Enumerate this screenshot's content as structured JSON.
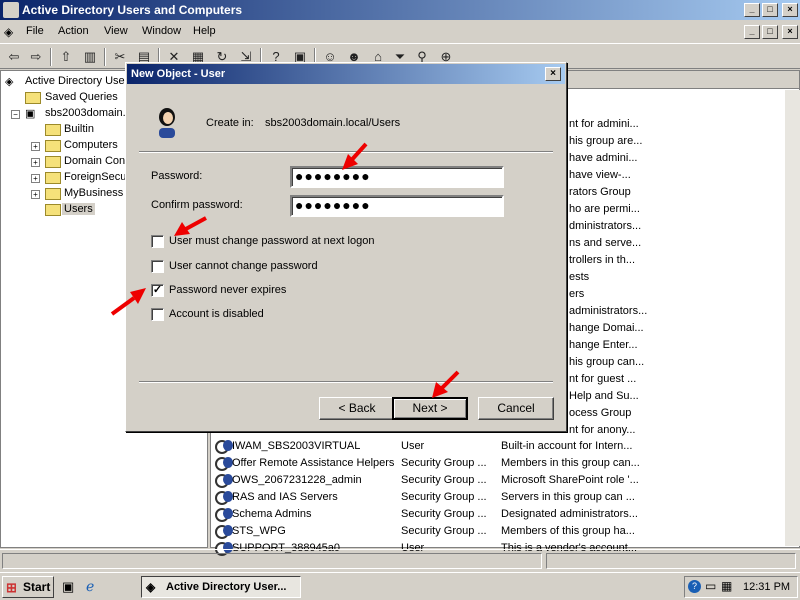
{
  "window": {
    "title": "Active Directory Users and Computers",
    "controls": [
      "_",
      "□",
      "×"
    ]
  },
  "menu": [
    "File",
    "Action",
    "View",
    "Window",
    "Help"
  ],
  "tree": {
    "root": "Active Directory User",
    "items": [
      {
        "label": "Saved Queries"
      },
      {
        "label": "sbs2003domain.l"
      },
      {
        "label": "Builtin"
      },
      {
        "label": "Computers"
      },
      {
        "label": "Domain Cont"
      },
      {
        "label": "ForeignSecur"
      },
      {
        "label": "MyBusiness"
      },
      {
        "label": "Users"
      }
    ]
  },
  "list": {
    "partial_descriptions": [
      "nt for admini...",
      "his group are...",
      "have admini...",
      "have view-...",
      "rators Group",
      "ho are permi...",
      "dministrators...",
      "ns and serve...",
      "trollers in th...",
      "ests",
      "ers",
      "administrators...",
      "hange Domai...",
      "hange Enter...",
      "his group can...",
      "nt for guest ...",
      "Help and Su...",
      "ocess Group",
      "nt for anony..."
    ],
    "rows": [
      {
        "name": "IWAM_SBS2003VIRTUAL",
        "type": "User",
        "description": "Built-in account for Intern..."
      },
      {
        "name": "Offer Remote Assistance Helpers",
        "type": "Security Group ...",
        "description": "Members in this group can..."
      },
      {
        "name": "OWS_2067231228_admin",
        "type": "Security Group ...",
        "description": "Microsoft SharePoint role '..."
      },
      {
        "name": "RAS and IAS Servers",
        "type": "Security Group ...",
        "description": "Servers in this group can ..."
      },
      {
        "name": "Schema Admins",
        "type": "Security Group ...",
        "description": "Designated administrators..."
      },
      {
        "name": "STS_WPG",
        "type": "Security Group ...",
        "description": "Members of this group ha..."
      },
      {
        "name": "SUPPORT_388945a0",
        "type": "User",
        "description": "This is a vendor's account..."
      }
    ]
  },
  "dialog": {
    "title": "New Object - User",
    "create_in_label": "Create in:",
    "create_in_value": "sbs2003domain.local/Users",
    "password_label": "Password:",
    "password_value": "●●●●●●●●",
    "confirm_label": "Confirm password:",
    "confirm_value": "●●●●●●●●",
    "checkboxes": [
      {
        "label": "User must change password at next logon",
        "checked": false
      },
      {
        "label": "User cannot change password",
        "checked": false
      },
      {
        "label": "Password never expires",
        "checked": true
      },
      {
        "label": "Account is disabled",
        "checked": false
      }
    ],
    "back_label": "< Back",
    "next_label": "Next >",
    "cancel_label": "Cancel",
    "close_glyph": "×"
  },
  "taskbar": {
    "start_label": "Start",
    "task_label": "Active Directory User...",
    "clock": "12:31 PM"
  },
  "colors": {
    "title_gradient_start": "#0a246a",
    "title_gradient_end": "#a6caf0",
    "annotation_arrow": "#ee0000"
  }
}
